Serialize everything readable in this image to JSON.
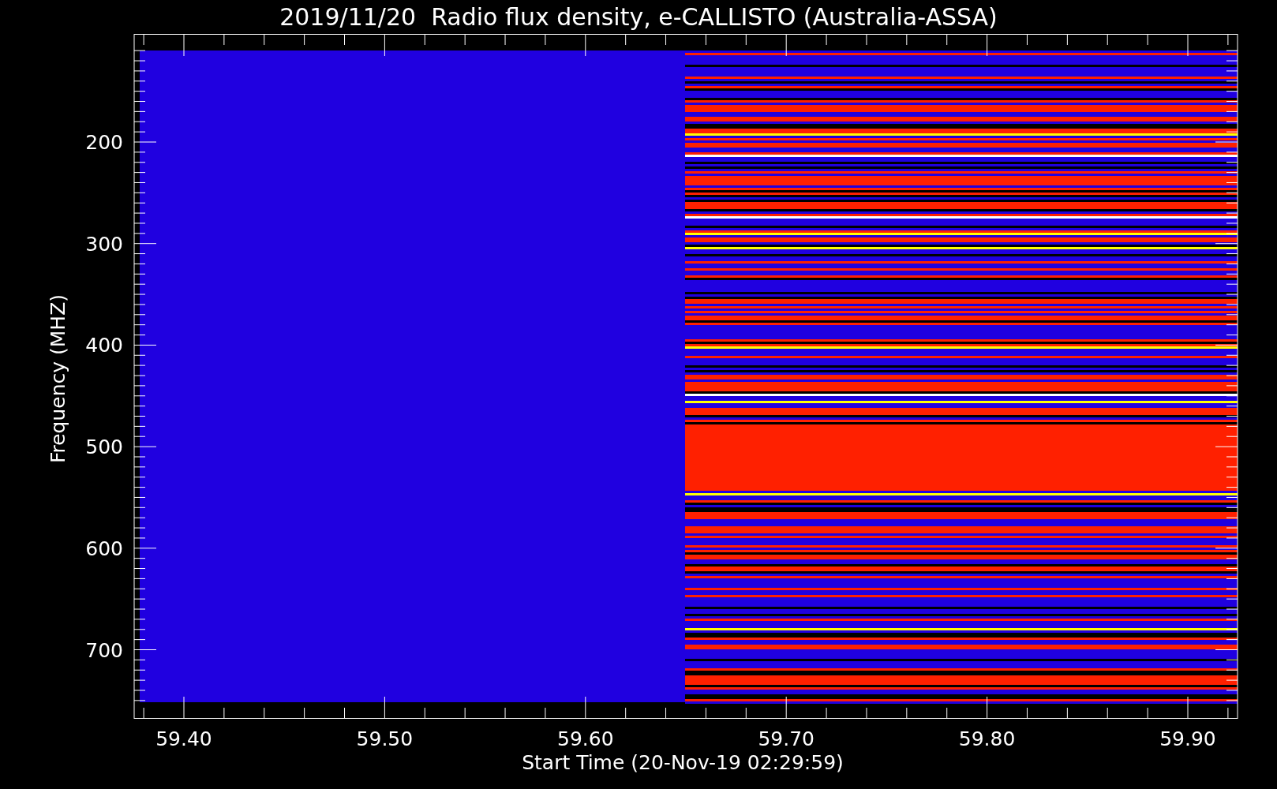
{
  "title": "2019/11/20  Radio flux density, e-CALLISTO (Australia-ASSA)",
  "y_axis": {
    "label": "Frequency (MHZ)",
    "ticks": [
      "200",
      "300",
      "400",
      "500",
      "600",
      "700"
    ]
  },
  "x_axis": {
    "label": "Start Time (20-Nov-19 02:29:59)",
    "ticks": [
      "59.40",
      "59.50",
      "59.60",
      "59.70",
      "59.80",
      "59.90"
    ]
  }
}
